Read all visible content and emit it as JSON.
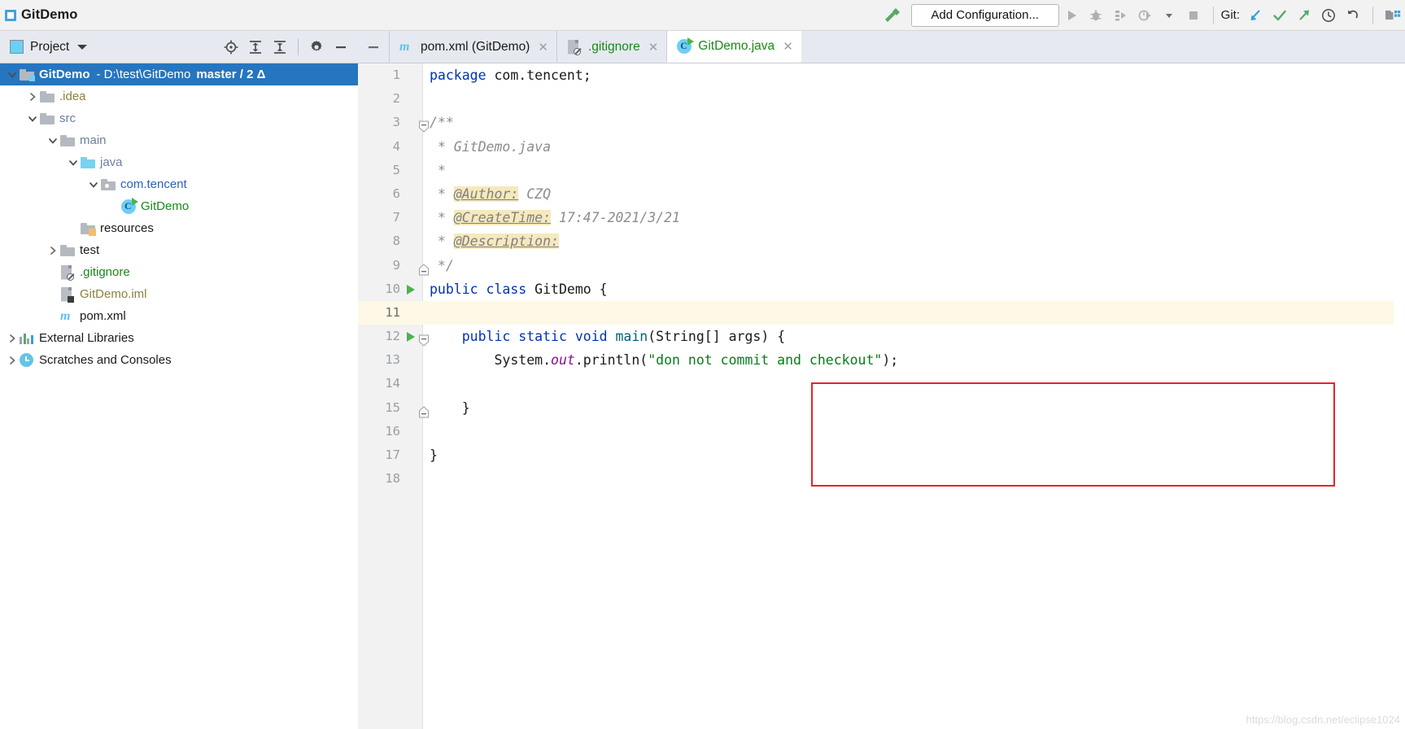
{
  "window": {
    "title": "GitDemo",
    "project_badge_icon": "project-badge-icon"
  },
  "toolbar": {
    "build_icon": "hammer-build-icon",
    "add_configuration_label": "Add Configuration...",
    "run_icon": "run-triangle-icon",
    "debug_icon": "debug-bug-icon",
    "run_coverage_icon": "run-with-coverage-icon",
    "profiler_icon": "profiler-icon",
    "dropdown_icon": "chevron-down-icon",
    "stop_icon": "stop-square-icon",
    "git_label": "Git:",
    "update_project_icon": "update-project-arrow-icon",
    "commit_icon": "commit-checkmark-icon",
    "push_icon": "push-arrow-icon",
    "history_icon": "history-clock-icon",
    "rollback_icon": "rollback-undo-icon",
    "search_everywhere_icon": "search-everywhere-icon"
  },
  "project_pane": {
    "title": "Project",
    "dropdown_icon": "chevron-down-icon",
    "locate_icon": "scroll-from-source-icon",
    "expand_icon": "expand-all-icon",
    "collapse_icon": "collapse-all-icon",
    "settings_icon": "gear-icon",
    "hide_icon": "hide-minus-icon",
    "tree": [
      {
        "label": "GitDemo",
        "detail": "- D:\\test\\GitDemo",
        "branch": "master / 2 Δ",
        "indent": 0,
        "arrow": "down",
        "icon": "module-folder-icon",
        "style": "selected"
      },
      {
        "label": ".idea",
        "indent": 1,
        "arrow": "right",
        "icon": "folder-icon",
        "style": "olive"
      },
      {
        "label": "src",
        "indent": 1,
        "arrow": "down",
        "icon": "folder-icon",
        "style": "bluegray"
      },
      {
        "label": "main",
        "indent": 2,
        "arrow": "down",
        "icon": "folder-icon",
        "style": "bluegray"
      },
      {
        "label": "java",
        "indent": 3,
        "arrow": "down",
        "icon": "source-folder-icon",
        "style": "bluegray"
      },
      {
        "label": "com.tencent",
        "indent": 4,
        "arrow": "down",
        "icon": "package-icon",
        "style": "pkgblue"
      },
      {
        "label": "GitDemo",
        "indent": 5,
        "arrow": "none",
        "icon": "java-class-icon",
        "style": "green"
      },
      {
        "label": "resources",
        "indent": 3,
        "arrow": "none",
        "icon": "resources-folder-icon",
        "style": "plain"
      },
      {
        "label": "test",
        "indent": 2,
        "arrow": "right",
        "icon": "folder-icon",
        "style": "plain"
      },
      {
        "label": ".gitignore",
        "indent": 2,
        "arrow": "none",
        "icon": "gitignore-file-icon",
        "style": "green"
      },
      {
        "label": "GitDemo.iml",
        "indent": 2,
        "arrow": "none",
        "icon": "iml-file-icon",
        "style": "olive"
      },
      {
        "label": "pom.xml",
        "indent": 2,
        "arrow": "none",
        "icon": "maven-file-icon",
        "style": "plain"
      },
      {
        "label": "External Libraries",
        "indent": 0,
        "arrow": "right",
        "icon": "libraries-icon",
        "style": "plain"
      },
      {
        "label": "Scratches and Consoles",
        "indent": 0,
        "arrow": "right",
        "icon": "scratches-icon",
        "style": "plain"
      }
    ]
  },
  "editor": {
    "hide_tool_window_icon": "minus-icon",
    "tabs": [
      {
        "label": "pom.xml (GitDemo)",
        "icon": "maven-file-icon",
        "active": false,
        "color": "plain",
        "close_icon": "close-icon"
      },
      {
        "label": ".gitignore",
        "icon": "gitignore-file-icon",
        "active": false,
        "color": "green",
        "close_icon": "close-icon"
      },
      {
        "label": "GitDemo.java",
        "icon": "java-class-icon",
        "active": true,
        "color": "green",
        "close_icon": "close-icon"
      }
    ],
    "caret_line": 11,
    "lines": [
      {
        "n": 1,
        "text": "package com.tencent;"
      },
      {
        "n": 2,
        "text": ""
      },
      {
        "n": 3,
        "text": "/**"
      },
      {
        "n": 4,
        "text": " * GitDemo.java"
      },
      {
        "n": 5,
        "text": " *"
      },
      {
        "n": 6,
        "text": " * @Author: CZQ"
      },
      {
        "n": 7,
        "text": " * @CreateTime: 17:47-2021/3/21"
      },
      {
        "n": 8,
        "text": " * @Description:"
      },
      {
        "n": 9,
        "text": " */"
      },
      {
        "n": 10,
        "text": "public class GitDemo {"
      },
      {
        "n": 11,
        "text": ""
      },
      {
        "n": 12,
        "text": "    public static void main(String[] args) {"
      },
      {
        "n": 13,
        "text": "        System.out.println(\"don not commit and checkout\");"
      },
      {
        "n": 14,
        "text": ""
      },
      {
        "n": 15,
        "text": "    }"
      },
      {
        "n": 16,
        "text": ""
      },
      {
        "n": 17,
        "text": "}"
      },
      {
        "n": 18,
        "text": ""
      }
    ],
    "watermark": "https://blog.csdn.net/eclipse1024"
  },
  "colors": {
    "selection_blue": "#2675bf",
    "vcs_green": "#168b16",
    "vcs_ignored_olive": "#8a8140",
    "keyword_blue": "#0033b3",
    "string_green": "#067d17",
    "static_field_purple": "#871094",
    "method_teal": "#00627a",
    "comment_gray": "#8c8c8c",
    "javadoc_tag_highlight": "#f5e9bd",
    "caret_row": "#fdf9e6",
    "annotation_red": "#e8232a",
    "toolbar_bg": "#f2f2f2",
    "pane_header_bg": "#e6eaf0"
  }
}
